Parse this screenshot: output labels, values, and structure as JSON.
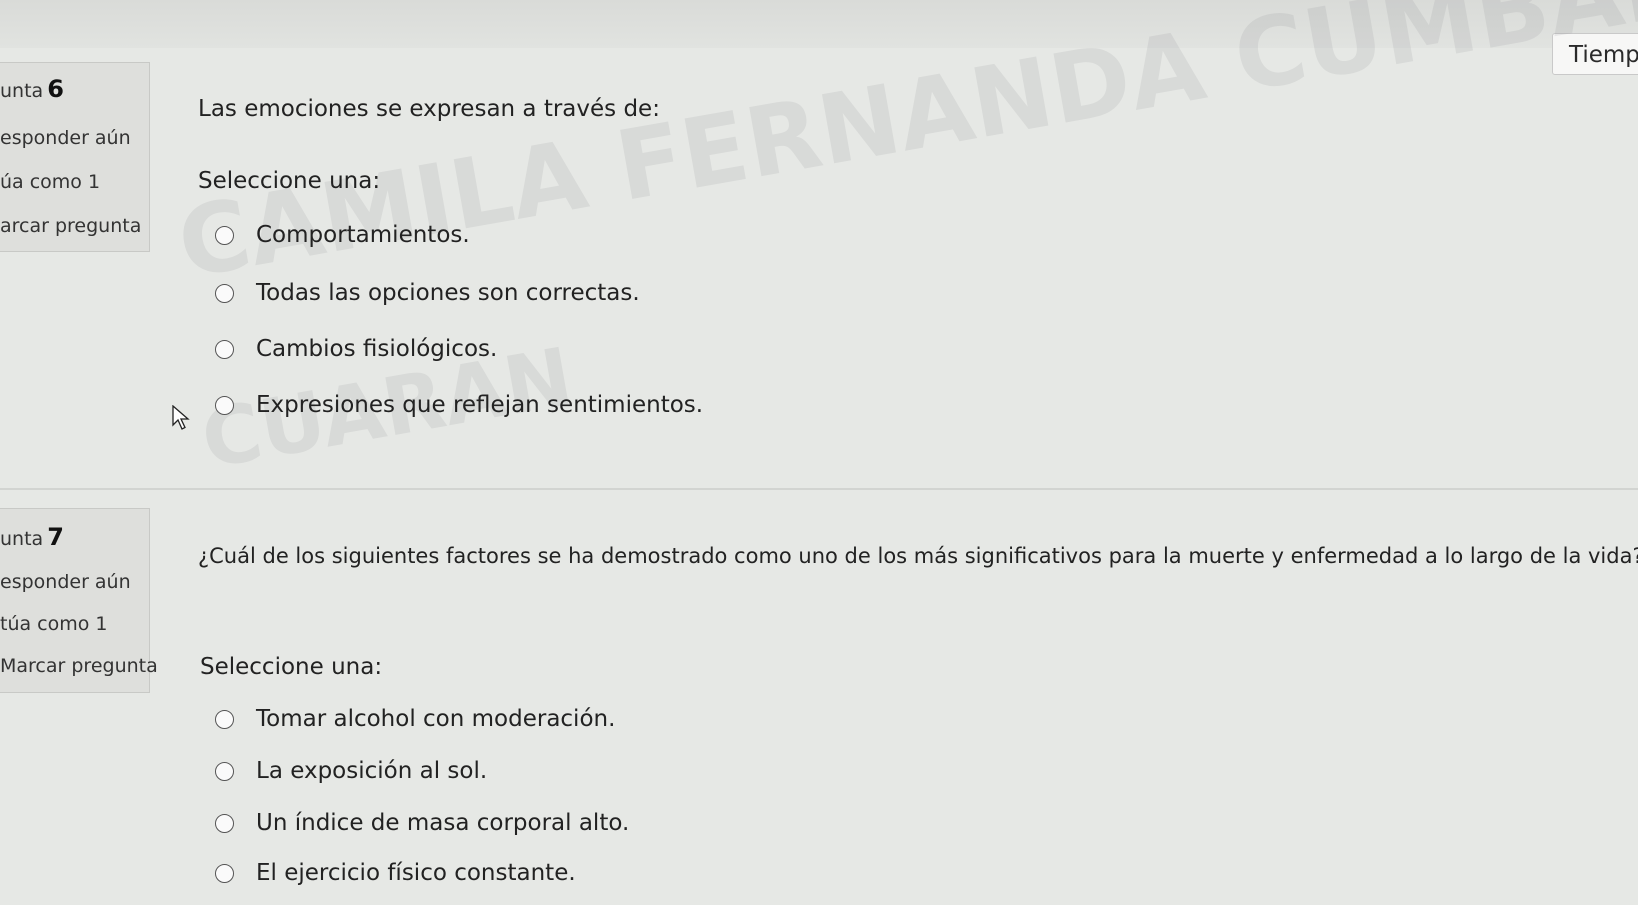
{
  "timer": {
    "label": "Tiempo"
  },
  "watermark": {
    "line1": "CAMILA FERNANDA CUMBAL",
    "line2": "CUARAN"
  },
  "questions": [
    {
      "prefix": "unta",
      "number": "6",
      "status": "esponder aún",
      "grade": "úa como 1",
      "flag": "arcar pregunta",
      "text": "Las emociones se expresan a través de:",
      "select_label": "Seleccione una:",
      "options": [
        "Comportamientos.",
        "Todas las opciones son correctas.",
        "Cambios fisiológicos.",
        "Expresiones que reflejan sentimientos."
      ]
    },
    {
      "prefix": "unta",
      "number": "7",
      "status": "esponder aún",
      "grade": "túa como 1",
      "flag": "Marcar pregunta",
      "text": "¿Cuál de los siguientes factores se ha demostrado como uno de los más significativos para la muerte y enfermedad a lo largo de la vida?",
      "select_label": "Seleccione una:",
      "options": [
        "Tomar alcohol con moderación.",
        "La exposición al sol.",
        "Un índice de masa corporal alto.",
        "El ejercicio físico constante."
      ]
    }
  ]
}
